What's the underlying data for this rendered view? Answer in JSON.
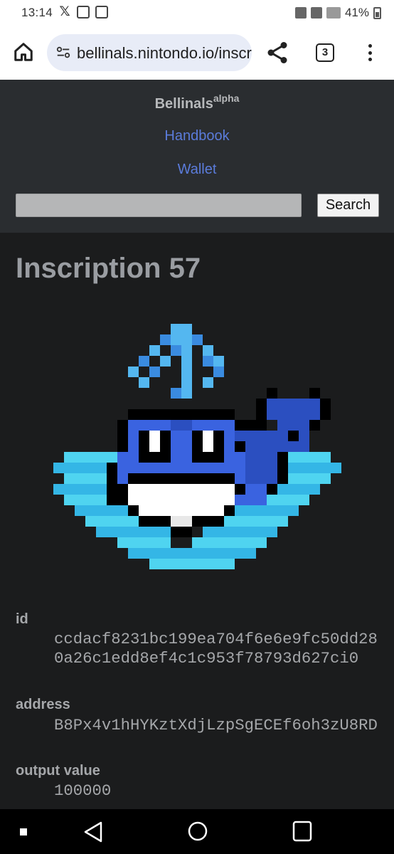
{
  "status_bar": {
    "time": "13:14",
    "battery": "41%",
    "icons": [
      "x-logo-icon",
      "image-icon",
      "activity-icon",
      "mute-icon",
      "5g-icon",
      "signal-icon",
      "battery-icon"
    ]
  },
  "browser": {
    "url": "bellinals.nintondo.io/inscription/ccdacf",
    "tab_count": "3",
    "icons": [
      "home-icon",
      "site-settings-icon",
      "share-icon",
      "tabs-icon",
      "menu-icon"
    ]
  },
  "header": {
    "brand": "Bellinals",
    "brand_sup": "alpha",
    "nav": {
      "handbook": "Handbook",
      "wallet": "Wallet"
    },
    "search": {
      "placeholder": "",
      "button_label": "Search"
    }
  },
  "inscription": {
    "title": "Inscription 57",
    "image_alt": "Pixel art whale",
    "fields": [
      {
        "label": "id",
        "value": "ccdacf8231bc199ea704f6e6e9fc50dd280a26c1edd8ef4c1c953f78793d627ci0"
      },
      {
        "label": "address",
        "value": "B8Px4v1hHYKztXdjLzpSgECEf6oh3zU8RD"
      },
      {
        "label": "output value",
        "value": "100000"
      }
    ]
  },
  "colors": {
    "header_bg": "#2a2d30",
    "page_bg": "#1b1c1d",
    "link": "#5b7cdb",
    "text": "#a5a7aa",
    "whale_blue": "#3a63e0",
    "water_light": "#4fd4f0",
    "water_mid": "#34b6e6"
  },
  "nav_bar": {
    "icons": [
      "recents-icon",
      "home-icon",
      "back-icon"
    ]
  }
}
